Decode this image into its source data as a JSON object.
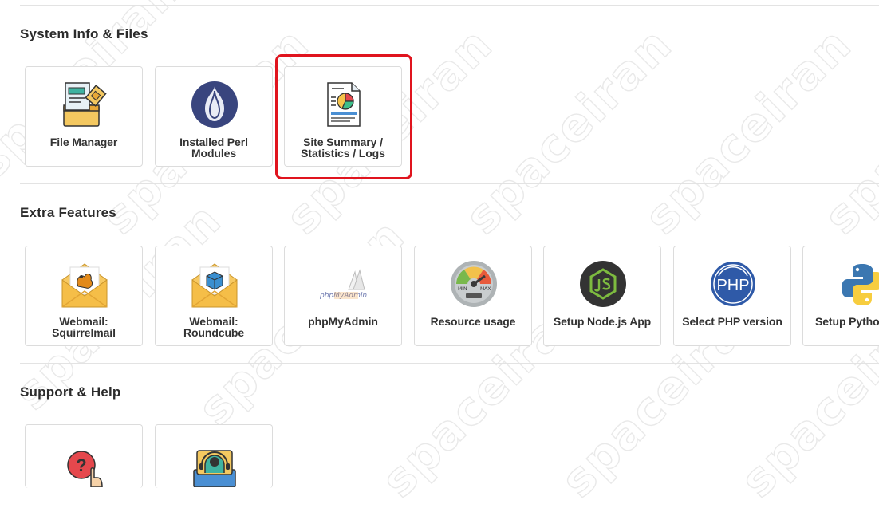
{
  "watermark_text": "spaceiran",
  "sections": [
    {
      "title": "System Info & Files",
      "tiles": [
        {
          "label": "File Manager",
          "icon": "file-manager-icon"
        },
        {
          "label": "Installed Perl Modules",
          "icon": "perl-onion-icon"
        },
        {
          "label": "Site Summary / Statistics / Logs",
          "icon": "statistics-document-icon"
        }
      ]
    },
    {
      "title": "Extra Features",
      "tiles": [
        {
          "label": "Webmail: Squirrelmail",
          "icon": "squirrelmail-envelope-icon"
        },
        {
          "label": "Webmail: Roundcube",
          "icon": "roundcube-envelope-icon"
        },
        {
          "label": "phpMyAdmin",
          "icon": "phpmyadmin-icon",
          "logo_text": "phpMyAdmin"
        },
        {
          "label": "Resource usage",
          "icon": "gauge-icon",
          "gauge_min": "MIN",
          "gauge_max": "MAX"
        },
        {
          "label": "Setup Node.js App",
          "icon": "nodejs-icon"
        },
        {
          "label": "Select PHP version",
          "icon": "php-icon",
          "logo_text": "PHP"
        },
        {
          "label": "Setup Pytho",
          "icon": "python-icon"
        }
      ]
    },
    {
      "title": "Support & Help",
      "tiles": [
        {
          "label": "",
          "icon": "help-question-icon"
        },
        {
          "label": "",
          "icon": "support-headset-icon"
        }
      ]
    }
  ],
  "highlight_color": "#e0141e"
}
